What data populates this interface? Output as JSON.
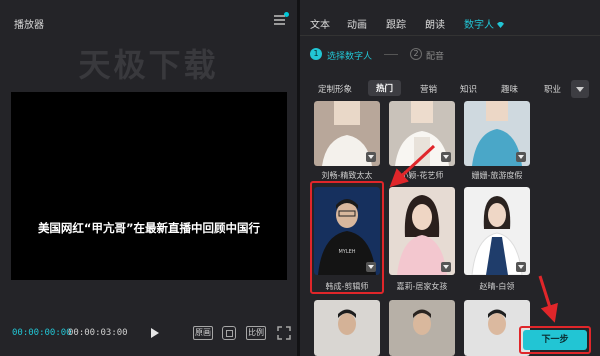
{
  "player": {
    "title": "播放器",
    "watermark": "天极下载",
    "subtitle": "美国网红“甲亢哥”在最新直播中回顾中国行",
    "time_current": "00:00:00:00",
    "time_total": "00:00:03:00",
    "btn_original": "原画",
    "btn_ratio": "比例"
  },
  "tabs": [
    {
      "label": "文本"
    },
    {
      "label": "动画"
    },
    {
      "label": "跟踪"
    },
    {
      "label": "朗读"
    },
    {
      "label": "数字人"
    }
  ],
  "steps": [
    {
      "num": "1",
      "label": "选择数字人"
    },
    {
      "num": "2",
      "label": "配音"
    }
  ],
  "categories": [
    "定制形象",
    "热门",
    "营销",
    "知识",
    "趣味",
    "职业"
  ],
  "avatars": [
    {
      "label": "刘畅-精致太太"
    },
    {
      "label": "小颖-花艺师"
    },
    {
      "label": "姗姗-旅游度假"
    },
    {
      "label": "韩成-剪辑师"
    },
    {
      "label": "嘉莉-居家女孩"
    },
    {
      "label": "赵晴-白领"
    }
  ],
  "next_label": "下一步",
  "colors": {
    "accent": "#22c5d4",
    "highlight": "#e0262a"
  }
}
